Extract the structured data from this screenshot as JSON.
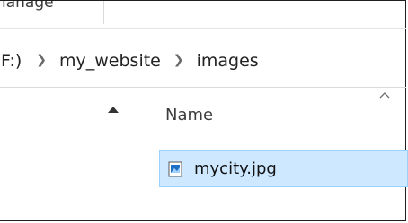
{
  "ribbon": {
    "tab_label": "lanage"
  },
  "breadcrumb": {
    "items": [
      {
        "label": "F:)"
      },
      {
        "label": "my_website"
      },
      {
        "label": "images"
      }
    ],
    "separator_icon": "chevron-right-icon"
  },
  "file_list": {
    "column_header": "Name",
    "sort_icon": "sort-ascending-icon",
    "scroll_icon": "scroll-up-icon",
    "files": [
      {
        "name": "mycity.jpg",
        "icon": "image-file-icon",
        "selected": true
      }
    ]
  },
  "colors": {
    "selection_fill": "#cde8ff",
    "selection_border": "#99d1ff",
    "image_icon_blue": "#1f6fc5"
  }
}
